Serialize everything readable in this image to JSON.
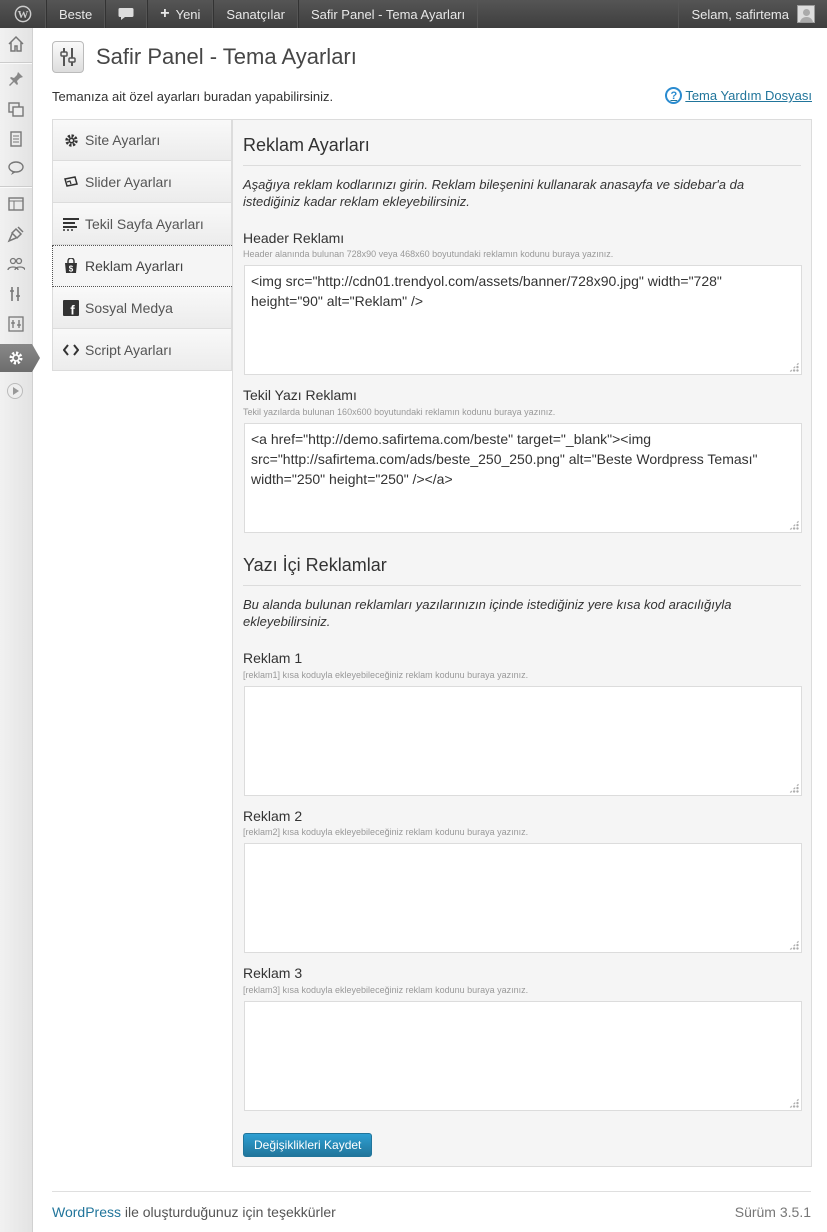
{
  "adminbar": {
    "site_name": "Beste",
    "new_label": "Yeni",
    "menu_item": "Sanatçılar",
    "current_page": "Safir Panel - Tema Ayarları",
    "greeting": "Selam, safirtema"
  },
  "page": {
    "title": "Safir Panel - Tema Ayarları",
    "description": "Temanıza ait özel ayarları buradan yapabilirsiniz.",
    "help_link": "Tema Yardım Dosyası"
  },
  "tabs": [
    {
      "label": "Site Ayarları",
      "icon": "gear-icon"
    },
    {
      "label": "Slider Ayarları",
      "icon": "slider-icon"
    },
    {
      "label": "Tekil Sayfa Ayarları",
      "icon": "lines-icon"
    },
    {
      "label": "Reklam Ayarları",
      "icon": "bag-icon",
      "active": true
    },
    {
      "label": "Sosyal Medya",
      "icon": "facebook-icon"
    },
    {
      "label": "Script Ayarları",
      "icon": "code-icon"
    }
  ],
  "ads": {
    "title": "Reklam Ayarları",
    "description": "Aşağıya reklam kodlarınızı girin. Reklam bileşenini kullanarak anasayfa ve sidebar'a da istediğiniz kadar reklam ekleyebilirsiniz.",
    "header": {
      "label": "Header Reklamı",
      "hint": "Header alanında bulunan 728x90 veya 468x60 boyutundaki reklamın kodunu buraya yazınız.",
      "value": "<img src=\"http://cdn01.trendyol.com/assets/banner/728x90.jpg\" width=\"728\" height=\"90\" alt=\"Reklam\" />"
    },
    "single": {
      "label": "Tekil Yazı Reklamı",
      "hint": "Tekil yazılarda bulunan 160x600 boyutundaki reklamın kodunu buraya yazınız.",
      "value": "<a href=\"http://demo.safirtema.com/beste\" target=\"_blank\"><img src=\"http://safirtema.com/ads/beste_250_250.png\" alt=\"Beste Wordpress Teması\" width=\"250\" height=\"250\" /></a>"
    }
  },
  "inline": {
    "title": "Yazı İçi Reklamlar",
    "description": "Bu alanda bulunan reklamları yazılarınızın içinde istediğiniz yere kısa kod aracılığıyla ekleyebilirsiniz.",
    "fields": [
      {
        "label": "Reklam 1",
        "hint": "[reklam1] kısa koduyla ekleyebileceğiniz reklam kodunu buraya yazınız.",
        "value": ""
      },
      {
        "label": "Reklam 2",
        "hint": "[reklam2] kısa koduyla ekleyebileceğiniz reklam kodunu buraya yazınız.",
        "value": ""
      },
      {
        "label": "Reklam 3",
        "hint": "[reklam3] kısa koduyla ekleyebileceğiniz reklam kodunu buraya yazınız.",
        "value": ""
      }
    ]
  },
  "save_label": "Değişiklikleri Kaydet",
  "footer": {
    "wp_link": "WordPress",
    "text": " ile oluşturduğunuz için teşekkürler",
    "version": "Sürüm 3.5.1"
  },
  "colors": {
    "accent": "#21759b",
    "adminbar": "#464646"
  }
}
